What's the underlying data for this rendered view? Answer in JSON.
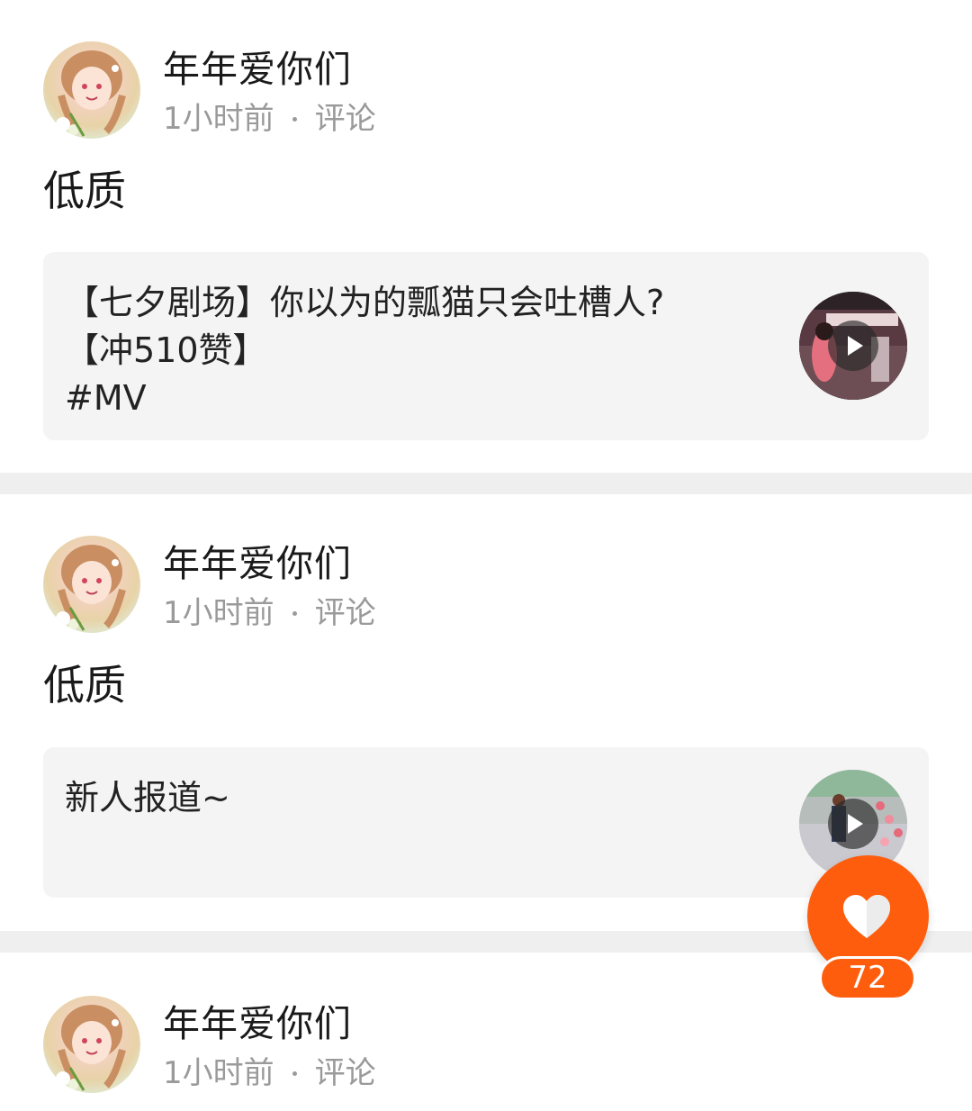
{
  "posts": [
    {
      "username": "年年爱你们",
      "time": "1小时前",
      "action": "评论",
      "text": "低质",
      "share": {
        "title_lines": [
          "【七夕剧场】你以为的瓢猫只会吐槽人?",
          "【冲510赞】",
          "#MV"
        ]
      }
    },
    {
      "username": "年年爱你们",
      "time": "1小时前",
      "action": "评论",
      "text": "低质",
      "share": {
        "title_lines": [
          "新人报道~"
        ]
      }
    },
    {
      "username": "年年爱你们",
      "time": "1小时前",
      "action": "评论"
    }
  ],
  "like_button": {
    "icon": "heart-icon",
    "count": "72",
    "color": "#fe5d0e"
  }
}
